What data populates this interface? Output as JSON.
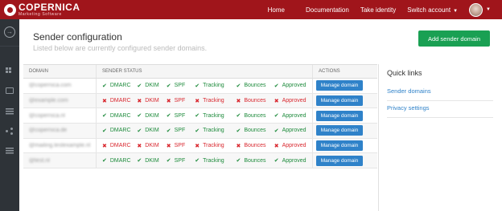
{
  "brand": {
    "name": "COPERNICA",
    "tagline": "Marketing Software"
  },
  "nav": {
    "home": "Home",
    "documentation": "Documentation",
    "take_identity": "Take identity",
    "switch_account": "Switch account"
  },
  "page": {
    "title": "Sender configuration",
    "subtitle": "Listed below are currently configured sender domains.",
    "add_button": "Add sender domain"
  },
  "table": {
    "headers": {
      "domain": "DOMAIN",
      "status": "SENDER STATUS",
      "actions": "ACTIONS"
    },
    "status_labels": [
      "DMARC",
      "DKIM",
      "SPF",
      "Tracking",
      "Bounces",
      "Approved"
    ],
    "action_label": "Manage domain",
    "rows": [
      {
        "domain": "@copernica.com",
        "status": [
          "ok",
          "ok",
          "ok",
          "ok",
          "ok",
          "ok"
        ]
      },
      {
        "domain": "@example.com",
        "status": [
          "bad",
          "bad",
          "bad",
          "bad",
          "bad",
          "bad"
        ]
      },
      {
        "domain": "@copernica.nl",
        "status": [
          "ok",
          "ok",
          "ok",
          "ok",
          "ok",
          "ok"
        ]
      },
      {
        "domain": "@copernica.de",
        "status": [
          "ok",
          "ok",
          "ok",
          "ok",
          "ok",
          "ok"
        ]
      },
      {
        "domain": "@mailing.testexample.nl",
        "status": [
          "bad",
          "bad",
          "bad",
          "bad",
          "bad",
          "bad"
        ]
      },
      {
        "domain": "@test.nl",
        "status": [
          "ok",
          "ok",
          "ok",
          "ok",
          "ok",
          "ok"
        ]
      }
    ]
  },
  "quick_links": {
    "title": "Quick links",
    "items": [
      "Sender domains",
      "Privacy settings"
    ]
  },
  "colors": {
    "topbar": "#a0151b",
    "ok": "#1e8b3c",
    "bad": "#d9282f",
    "primary": "#2f82c9",
    "success": "#1aa053"
  },
  "icons": {
    "ok": "check-icon",
    "bad": "cross-icon"
  }
}
